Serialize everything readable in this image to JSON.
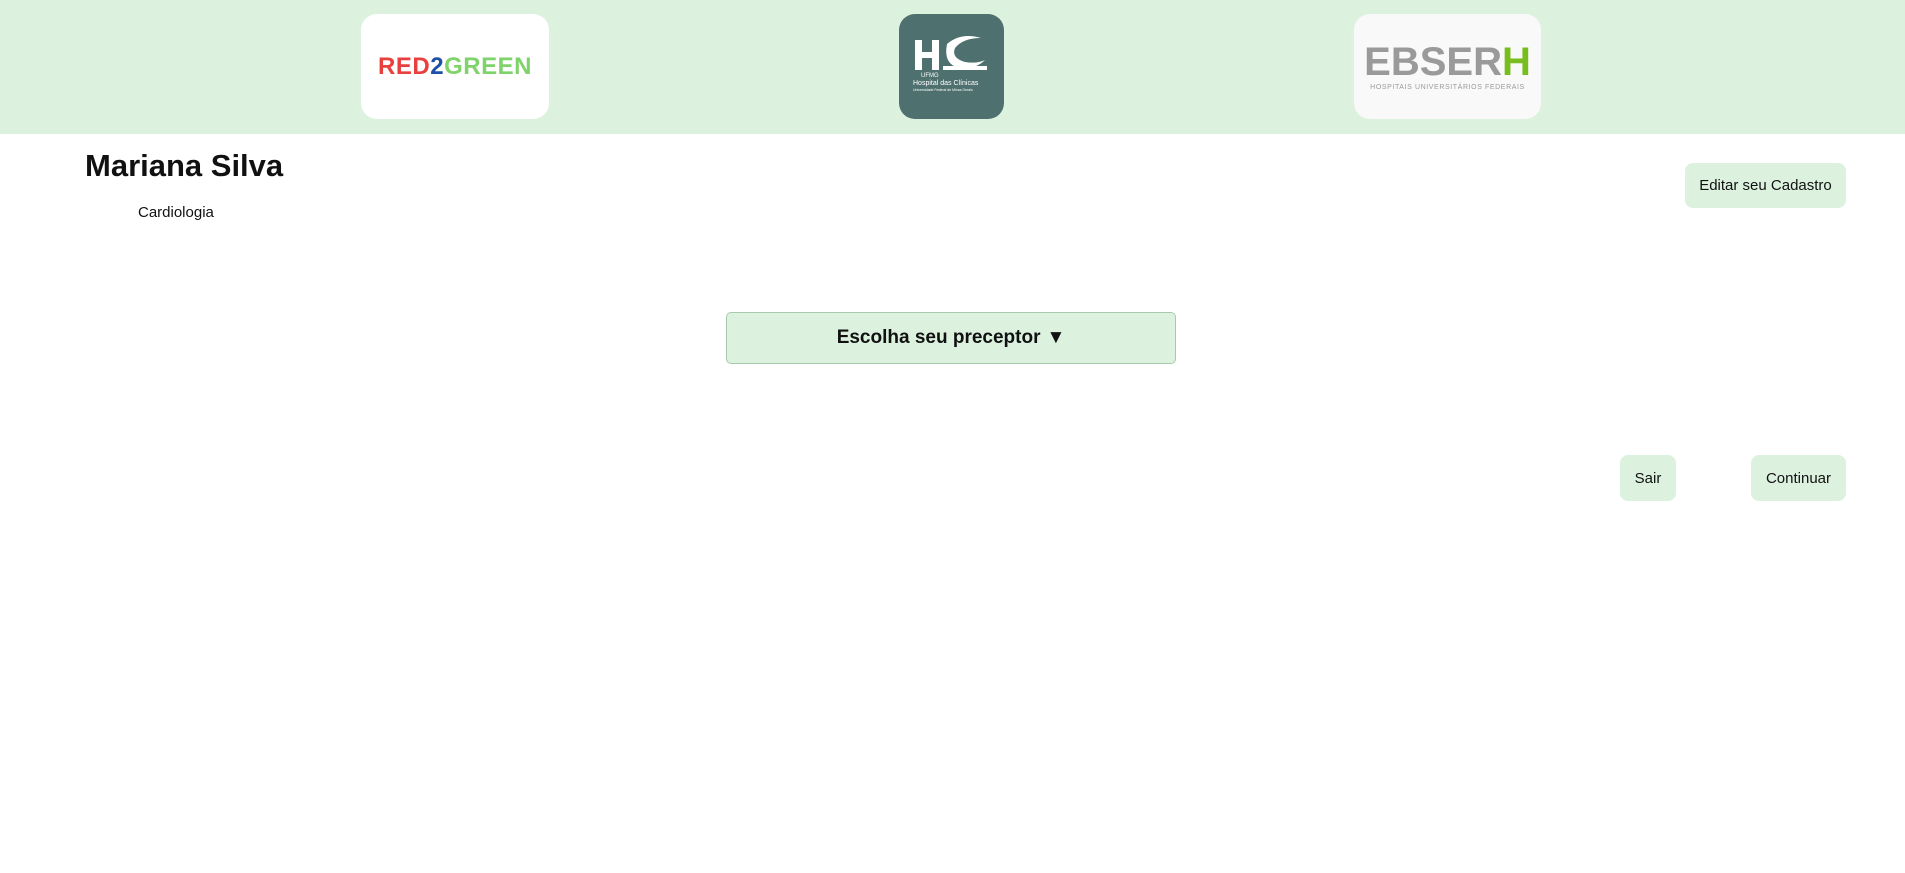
{
  "header": {
    "logos": {
      "red2green": {
        "part1": "RED",
        "part2": "2",
        "part3": "GREEN",
        "colors": {
          "red": "#e8413d",
          "blue": "#1f4fa7",
          "green": "#7fd36a"
        }
      },
      "hc": {
        "line1": "UFMG",
        "line2": "Hospital das Clínicas",
        "line3": "Universidade Federal de Minas Gerais",
        "bg": "#4e7170"
      },
      "ebserh": {
        "main": "EBSER",
        "h": "H",
        "sub": "HOSPITAIS UNIVERSITÁRIOS FEDERAIS"
      }
    },
    "bg": "#dcf2df"
  },
  "user": {
    "name": "Mariana Silva",
    "specialty": "Cardiologia"
  },
  "buttons": {
    "edit": "Editar seu Cadastro",
    "exit": "Sair",
    "continue": "Continuar"
  },
  "preceptor_select": {
    "label": "Escolha seu preceptor",
    "arrow": "▼"
  },
  "colors": {
    "accent": "#dcf2df",
    "text": "#111111"
  }
}
